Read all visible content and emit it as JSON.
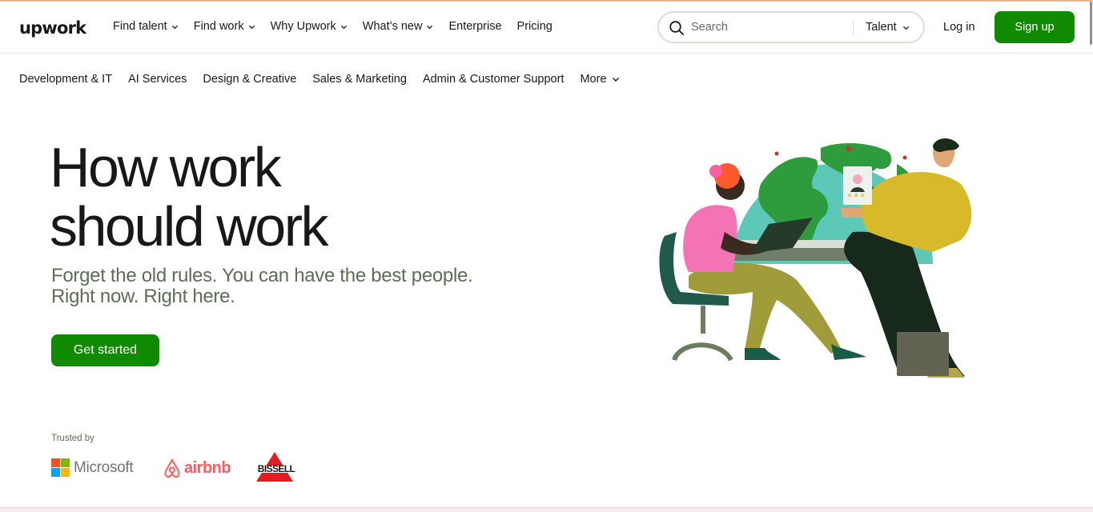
{
  "header": {
    "logo_text": "upwork",
    "nav": [
      {
        "label": "Find talent",
        "dropdown": true
      },
      {
        "label": "Find work",
        "dropdown": true
      },
      {
        "label": "Why Upwork",
        "dropdown": true
      },
      {
        "label": "What’s new",
        "dropdown": true
      },
      {
        "label": "Enterprise",
        "dropdown": false
      },
      {
        "label": "Pricing",
        "dropdown": false
      }
    ],
    "search": {
      "placeholder": "Search",
      "value": "",
      "type_selected": "Talent"
    },
    "login_label": "Log in",
    "signup_label": "Sign up"
  },
  "categories": {
    "items": [
      "Development & IT",
      "AI Services",
      "Design & Creative",
      "Sales & Marketing",
      "Admin & Customer Support"
    ],
    "more_label": "More"
  },
  "hero": {
    "title_line1": "How work",
    "title_line2": "should work",
    "subtitle_line1": "Forget the old rules. You can have the best people.",
    "subtitle_line2": "Right now. Right here.",
    "cta_label": "Get started"
  },
  "trusted": {
    "label": "Trusted by",
    "brands": [
      "Microsoft",
      "airbnb",
      "BISSELL"
    ]
  },
  "colors": {
    "brand_green": "#108a00",
    "text": "#181818",
    "subtitle": "#5e6d55",
    "airbnb": "#ff5a5f",
    "bissell": "#e31b23"
  },
  "icons": [
    "search-icon",
    "chevron-down-icon",
    "microsoft-logo",
    "airbnb-logo",
    "bissell-logo"
  ]
}
